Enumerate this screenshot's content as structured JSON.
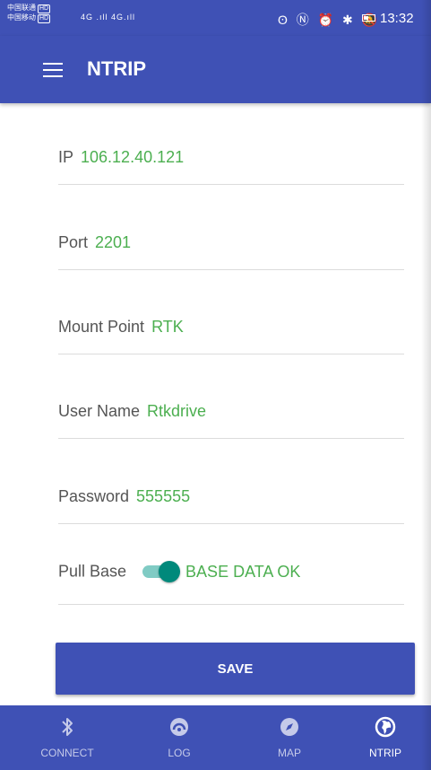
{
  "status_bar": {
    "carrier1": "中国联通",
    "carrier2": "中国移动",
    "hd_badge": "HD",
    "signal": "4G .ıll 4G.ıll",
    "system_icons": "ʘ Ⓝ ⏰ ✱ 🔕",
    "time": "13:32"
  },
  "app_bar": {
    "title": "NTRIP",
    "menu_icon": "menu-icon"
  },
  "form": {
    "ip": {
      "label": "IP",
      "value": "106.12.40.121"
    },
    "port": {
      "label": "Port",
      "value": "2201"
    },
    "mount_point": {
      "label": "Mount Point",
      "value": "RTK"
    },
    "user_name": {
      "label": "User Name",
      "value": "Rtkdrive"
    },
    "password": {
      "label": "Password",
      "value": "555555"
    },
    "pull_base": {
      "label": "Pull Base",
      "on": true,
      "status": "BASE DATA OK"
    }
  },
  "save_button": {
    "label": "SAVE"
  },
  "bottom_nav": {
    "items": [
      {
        "label": "CONNECT",
        "icon": "bluetooth-icon",
        "active": false
      },
      {
        "label": "LOG",
        "icon": "gauge-icon",
        "active": false
      },
      {
        "label": "MAP",
        "icon": "compass-icon",
        "active": false
      },
      {
        "label": "NTRIP",
        "icon": "globe-icon",
        "active": true
      }
    ]
  },
  "colors": {
    "primary": "#3f51b5",
    "value_green": "#4caf50",
    "toggle_teal": "#00897b"
  }
}
